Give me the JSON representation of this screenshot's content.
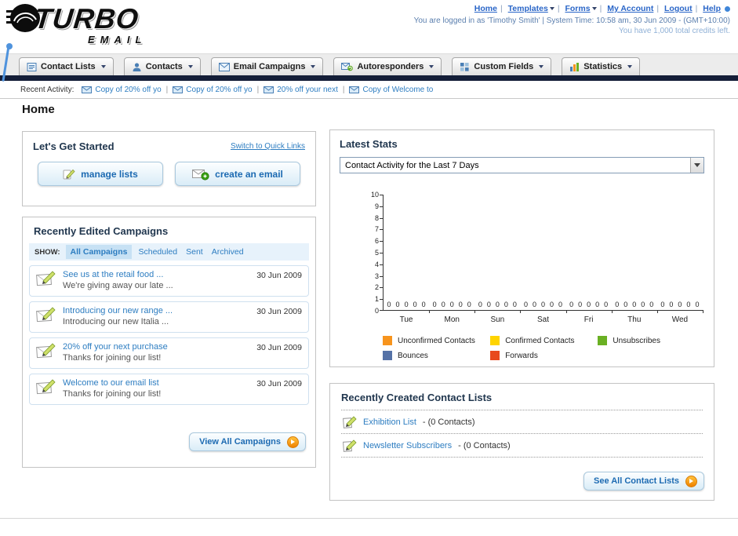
{
  "ui": {
    "separator": "|"
  },
  "header": {
    "logo_title": "TURBO",
    "logo_subtitle": "EMAIL",
    "nav_links": [
      "Home",
      "Templates",
      "Forms",
      "My Account",
      "Logout",
      "Help"
    ],
    "login_status": "You are logged in as 'Timothy Smith'",
    "system_time": "System Time: 10:58 am, 30 Jun 2009 - (GMT+10:00)",
    "credits": "You have 1,000 total credits left."
  },
  "nav_tabs": [
    "Contact Lists",
    "Contacts",
    "Email Campaigns",
    "Autoresponders",
    "Custom Fields",
    "Statistics"
  ],
  "recent_activity": {
    "label": "Recent Activity:",
    "items": [
      "Copy of 20% off yo",
      "Copy of 20% off yo",
      "20% off your next",
      "Copy of Welcome to"
    ]
  },
  "page_title": "Home",
  "get_started": {
    "title": "Let's Get Started",
    "switch_link": "Switch to Quick Links",
    "manage_lists_label": "manage lists",
    "create_email_label": "create an email"
  },
  "campaigns": {
    "title": "Recently Edited Campaigns",
    "show_label": "SHOW:",
    "filters": [
      "All Campaigns",
      "Scheduled",
      "Sent",
      "Archived"
    ],
    "active_filter": "All Campaigns",
    "items": [
      {
        "title": "See us at the retail food ...",
        "subtitle": "We're giving away our late ...",
        "date": "30 Jun 2009"
      },
      {
        "title": "Introducing our new range ...",
        "subtitle": "Introducing our new Italia ...",
        "date": "30 Jun 2009"
      },
      {
        "title": "20% off your next purchase",
        "subtitle": "Thanks for joining our list!",
        "date": "30 Jun 2009"
      },
      {
        "title": "Welcome to our email list",
        "subtitle": "Thanks for joining our list!",
        "date": "30 Jun 2009"
      }
    ],
    "view_all_label": "View All Campaigns"
  },
  "stats": {
    "title": "Latest Stats",
    "selected_option": "Contact Activity for the Last 7 Days",
    "chart_data": {
      "type": "bar",
      "title": "Contact Activity for the Last 7 Days",
      "categories": [
        "Tue",
        "Mon",
        "Sun",
        "Sat",
        "Fri",
        "Thu",
        "Wed"
      ],
      "series": [
        {
          "name": "Unconfirmed Contacts",
          "color": "#f7941d",
          "values": [
            0,
            0,
            0,
            0,
            0,
            0,
            0
          ]
        },
        {
          "name": "Confirmed Contacts",
          "color": "#ffd400",
          "values": [
            0,
            0,
            0,
            0,
            0,
            0,
            0
          ]
        },
        {
          "name": "Unsubscribes",
          "color": "#6ab023",
          "values": [
            0,
            0,
            0,
            0,
            0,
            0,
            0
          ]
        },
        {
          "name": "Bounces",
          "color": "#5572a7",
          "values": [
            0,
            0,
            0,
            0,
            0,
            0,
            0
          ]
        },
        {
          "name": "Forwards",
          "color": "#e8491d",
          "values": [
            0,
            0,
            0,
            0,
            0,
            0,
            0
          ]
        }
      ],
      "ylim": [
        0,
        10
      ],
      "ytick_step": 1,
      "value_labels_shown": true,
      "grid": false,
      "legend_position": "bottom"
    }
  },
  "contact_lists": {
    "title": "Recently Created Contact Lists",
    "items": [
      {
        "name": "Exhibition List",
        "count": "- (0 Contacts)"
      },
      {
        "name": "Newsletter Subscribers",
        "count": "- (0 Contacts)"
      }
    ],
    "see_all_label": "See All Contact Lists"
  },
  "colors": {
    "link_blue": "#2d7dc1",
    "dark_bar": "#141e38",
    "accent_orange": "#ef8200"
  }
}
